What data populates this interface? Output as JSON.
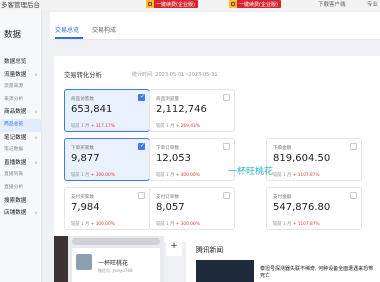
{
  "app": {
    "title": "多客管理后台"
  },
  "topbar": {
    "promos": [
      "一键续费(企业版)",
      "一键续费(企业版)"
    ],
    "right_links": [
      "下载客户端",
      "专业"
    ]
  },
  "sidebar": {
    "brand": "数据",
    "items": [
      {
        "label": "数据总览",
        "kind": "group"
      },
      {
        "label": "流量数据",
        "kind": "group",
        "caret": "v"
      },
      {
        "label": "流量来源",
        "kind": "sub"
      },
      {
        "label": "来源分析",
        "kind": "sub"
      },
      {
        "label": "商品数据",
        "kind": "group",
        "caret": "v"
      },
      {
        "label": "商品总览",
        "kind": "sub",
        "active": true
      },
      {
        "label": "笔记数据",
        "kind": "group",
        "caret": "v"
      },
      {
        "label": "笔记数据",
        "kind": "sub"
      },
      {
        "label": "直播数据",
        "kind": "group",
        "caret": "v"
      },
      {
        "label": "直播列表",
        "kind": "sub"
      },
      {
        "label": "直播分析",
        "kind": "sub"
      },
      {
        "label": "搜索数据",
        "kind": "group"
      },
      {
        "label": "店铺数据",
        "kind": "group",
        "caret": "v"
      }
    ]
  },
  "tabs": [
    {
      "label": "交易总览",
      "active": true
    },
    {
      "label": "交易构成",
      "active": false
    }
  ],
  "analysis": {
    "title": "交易转化分析",
    "period": "统计时间: 2023-05-01~2023-05-31"
  },
  "cards": [
    {
      "label": "商品访客数",
      "value": "653,841",
      "compare": "较前 1 月",
      "change": "+ 317.17%",
      "selected": true
    },
    {
      "label": "商品浏览量",
      "value": "2,112,746",
      "compare": "较前 1 月",
      "change": "+ 269.43%",
      "selected": false
    },
    {
      "label": "下单买家数",
      "value": "9,877",
      "compare": "较前 1 月",
      "change": "+ 300.00%",
      "selected": true
    },
    {
      "label": "下单订单数",
      "value": "12,053",
      "compare": "较前 1 月",
      "change": "+ 400.00%",
      "selected": false
    },
    {
      "label": "下单金额",
      "value": "819,604.50",
      "compare": "较前 1 月",
      "change": "+ 1107.87%",
      "selected": false
    },
    {
      "label": "支付买家数",
      "value": "7,984",
      "compare": "较前 1 月",
      "change": "+ 300.00%",
      "selected": false
    },
    {
      "label": "支付订单数",
      "value": "8,057",
      "compare": "较前 1 月",
      "change": "+ 300.00%",
      "selected": false
    },
    {
      "label": "支付金额",
      "value": "547,876.80",
      "compare": "较前 1 月",
      "change": "+ 1107.87%",
      "selected": false
    }
  ],
  "watermark": "一杯旺桃花",
  "profile": {
    "name": "一杯旺桃花",
    "id": "微信号: yueyu788"
  },
  "news": {
    "title": "腾讯新闻",
    "headline": "泰坦号探测器失联不稀奇, 何种设备全面遭遇来恐怖死亡"
  },
  "colors": {
    "accent": "#2f6ee6",
    "up": "#e23a3a",
    "promo": "#d8262e"
  }
}
